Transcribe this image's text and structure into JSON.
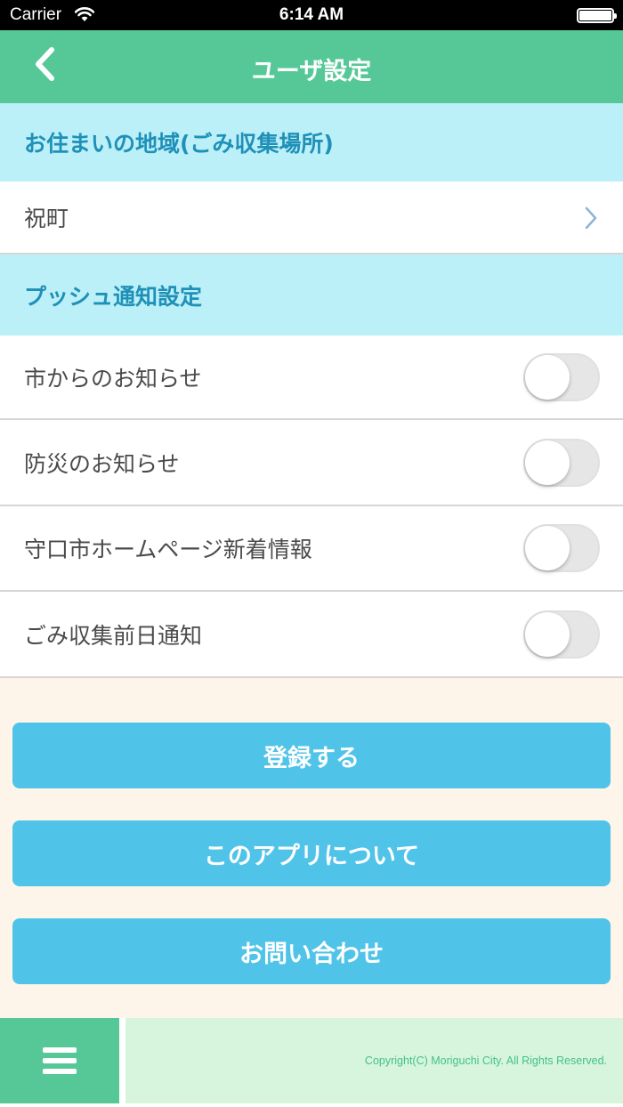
{
  "status_bar": {
    "carrier": "Carrier",
    "time": "6:14 AM",
    "wifi_icon": "wifi-icon",
    "battery_icon": "battery-icon"
  },
  "nav": {
    "title": "ユーザ設定",
    "back_icon": "chevron-left-icon"
  },
  "area_section": {
    "header": "お住まいの地域(ごみ収集場所)",
    "selected_area": "祝町",
    "chevron_icon": "chevron-right-icon"
  },
  "push_section": {
    "header": "プッシュ通知設定",
    "items": [
      {
        "label": "市からのお知らせ",
        "enabled": false
      },
      {
        "label": "防災のお知らせ",
        "enabled": false
      },
      {
        "label": "守口市ホームページ新着情報",
        "enabled": false
      },
      {
        "label": "ごみ収集前日通知",
        "enabled": false
      }
    ]
  },
  "buttons": {
    "register": "登録する",
    "about": "このアプリについて",
    "contact": "お問い合わせ"
  },
  "footer": {
    "menu_icon": "hamburger-menu-icon",
    "copyright": "Copyright(C) Moriguchi City. All Rights Reserved."
  },
  "colors": {
    "nav_green": "#56c898",
    "section_header_bg": "#bcf0f8",
    "section_header_text": "#1f90b8",
    "button_blue": "#50c3e8",
    "page_bg": "#fdf5ea",
    "footer_copy_bg": "#d6f5dc"
  }
}
